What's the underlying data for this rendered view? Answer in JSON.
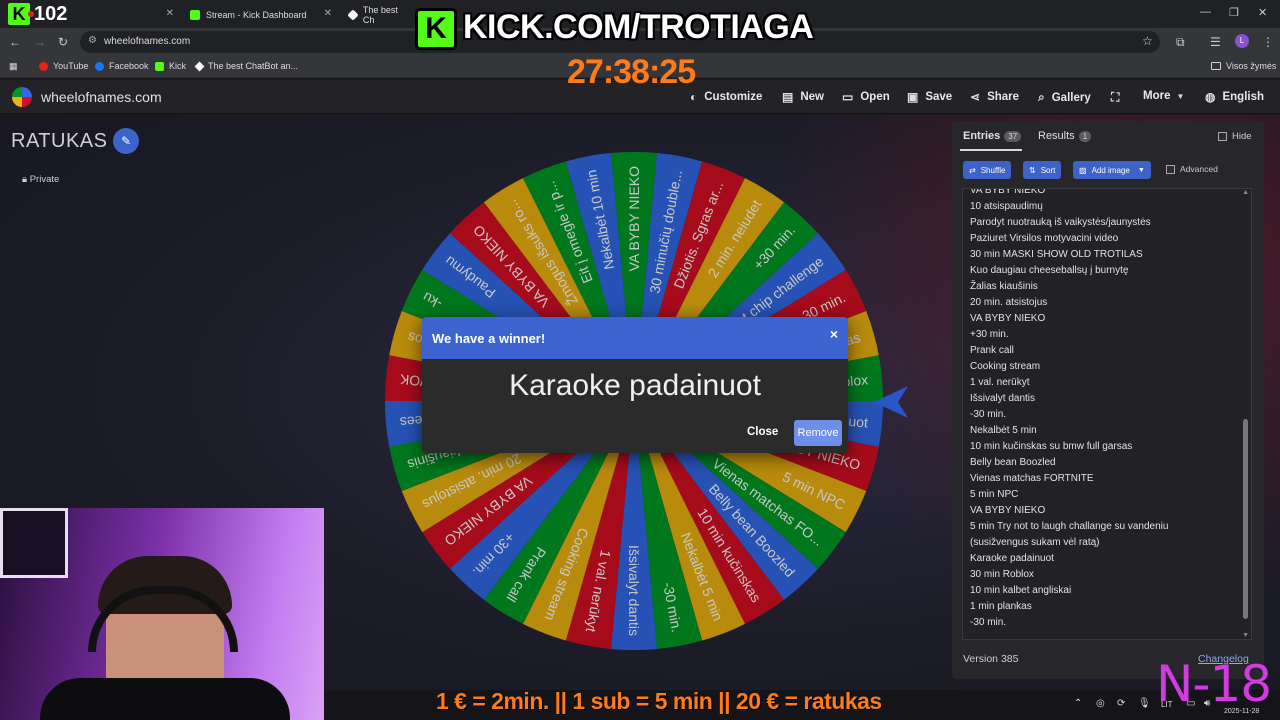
{
  "browser": {
    "tabs": [
      {
        "label": "",
        "favicon_color": "#53fc18"
      },
      {
        "label": "Stream - Kick Dashboard",
        "favicon_color": "#53fc18"
      },
      {
        "label": "The best Ch",
        "favicon_color": "#ffffff"
      }
    ],
    "url": "wheelofnames.com",
    "bookmarks": [
      "YouTube",
      "Facebook",
      "Kick",
      "The best ChatBot an..."
    ],
    "all_bookmarks": "Visos žymės",
    "profile_initial": "L"
  },
  "site": {
    "logo": "wheelofnames.com",
    "menu": [
      "Customize",
      "New",
      "Open",
      "Save",
      "Share",
      "Gallery",
      "More",
      "English"
    ]
  },
  "wheel_page": {
    "title": "RATUKAS",
    "visibility": "Private"
  },
  "wheel": {
    "colors": [
      "#009925",
      "#3369e8",
      "#d50f25",
      "#eeb211"
    ],
    "slices": [
      "VA BYBY NIEKO",
      "30 minučių double...",
      "Džiotis. Sgras ar...",
      "2 min. neiudet",
      "+30 min.",
      "Hot chip challenge",
      "-30 min.",
      "1 min plankas",
      "roblox",
      "Karaoke padainuot",
      "VA BYBY NIEKO",
      "5 min NPC",
      "Vienas matchas FO...",
      "Belly bean Boozled",
      "10 min kučinskas",
      "Nekalbėt 5 min",
      "-30 min.",
      "Išsivalyt dantis",
      "1 val. nerūkyt",
      "Cooking stream",
      "Prank call",
      "+30 min.",
      "VA BYBY NIEKO",
      "20 min. atsistojus",
      "Žalias kiaušinis",
      "ees",
      "WOK",
      "llos",
      "-ku",
      "Paudymu",
      "VA BYBY NIEKO",
      "Žmogus išsuks ro...",
      "Eit į omegle ir p...",
      "Nekalbėt 10 min"
    ]
  },
  "modal": {
    "title": "We have a winner!",
    "winner": "Karaoke padainuot",
    "close_label": "Close",
    "remove_label": "Remove",
    "close_icon": "×"
  },
  "panel": {
    "tabs": [
      {
        "label": "Entries",
        "count": "37"
      },
      {
        "label": "Results",
        "count": "1"
      }
    ],
    "hide_label": "Hide",
    "buttons": [
      "Shuffle",
      "Sort",
      "Add image"
    ],
    "advanced_label": "Advanced",
    "entries": [
      "VA BYBY NIEKO",
      "10 atsispaudimų",
      "Parodyt nuotrauką iš vaikystės/jaunystės",
      "Paziuret Virsilos motyvacini video",
      "30 min MASKI SHOW OLD TROTILAS",
      "Kuo daugiau cheeseballsų į burnytę",
      "Žalias kiaušinis",
      "20 min. atsistojus",
      "VA BYBY NIEKO",
      "+30 min.",
      "Prank call",
      "Cooking stream",
      "1 val. nerūkyt",
      "Išsivalyt dantis",
      "-30 min.",
      "Nekalbėt 5 min",
      "10 min kučinskas su bmw full garsas",
      "Belly bean Boozled",
      "Vienas matchas FORTNITE",
      "5 min NPC",
      "VA BYBY NIEKO",
      "5 min Try not to laugh challange su vandeniu",
      "(susižvengus sukam vėl ratą)",
      "Karaoke padainuot",
      "30 min Roblox",
      "10 min kalbet angliskai",
      "1 min plankas",
      "-30 min."
    ],
    "version": "Version 385",
    "changelog": "Changelog"
  },
  "stream_overlay": {
    "viewer_count": "102",
    "banner": "KICK.COM/TROTIAGA",
    "timer": "27:38:25",
    "promo": "1 € = 2min. || 1 sub = 5 min || 20 € = ratukas",
    "rating": "N-18",
    "tray_lang": "LIT",
    "date": "2025-11-28"
  }
}
